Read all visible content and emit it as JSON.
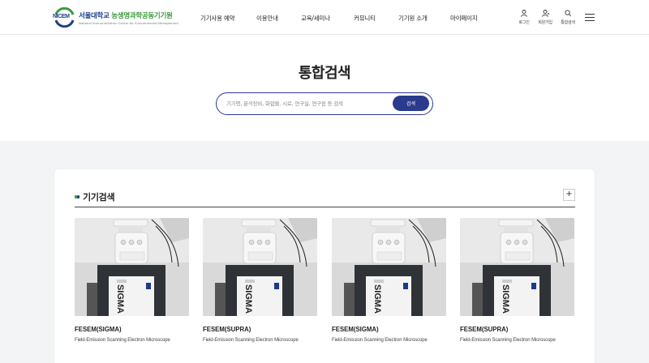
{
  "header": {
    "logo_abbr": "NICEM",
    "logo_univ": "서울대학교",
    "logo_inst": "농생명과학공동기기원",
    "logo_sub": "National Instrumentation Center for Environmental Management",
    "nav": [
      "기기사용 예약",
      "이용안내",
      "교육/세미나",
      "커뮤니티",
      "기기원 소개",
      "마이페이지"
    ],
    "util": {
      "login": "로그인",
      "signup": "회원가입",
      "search": "통합검색"
    }
  },
  "hero": {
    "title": "통합검색",
    "search_placeholder": "기기명, 분석장비, 화합물, 시료, 연구실, 연구원 등 검색",
    "search_button": "검색"
  },
  "section": {
    "title": "기기검색",
    "more_label": "+",
    "products": [
      {
        "name": "FESEM(SIGMA)",
        "desc": "Field-Emission Scanning Electron Microscope",
        "brand": "SIGMA"
      },
      {
        "name": "FESEM(SUPRA)",
        "desc": "Field-Emission Scanning Electron Microscope",
        "brand": "SIGMA"
      },
      {
        "name": "FESEM(SIGMA)",
        "desc": "Field-Emission Scanning Electron Microscope",
        "brand": "SIGMA"
      },
      {
        "name": "FESEM(SUPRA)",
        "desc": "Field-Emission Scanning Electron Microscope",
        "brand": "SIGMA"
      }
    ]
  },
  "colors": {
    "primary": "#2b3a8c",
    "logo_green": "#3a9a3e",
    "bg": "#f3f4f6"
  },
  "icons": {
    "login": "person-icon",
    "signup": "person-add-icon",
    "search": "search-icon",
    "menu": "hamburger-icon"
  }
}
